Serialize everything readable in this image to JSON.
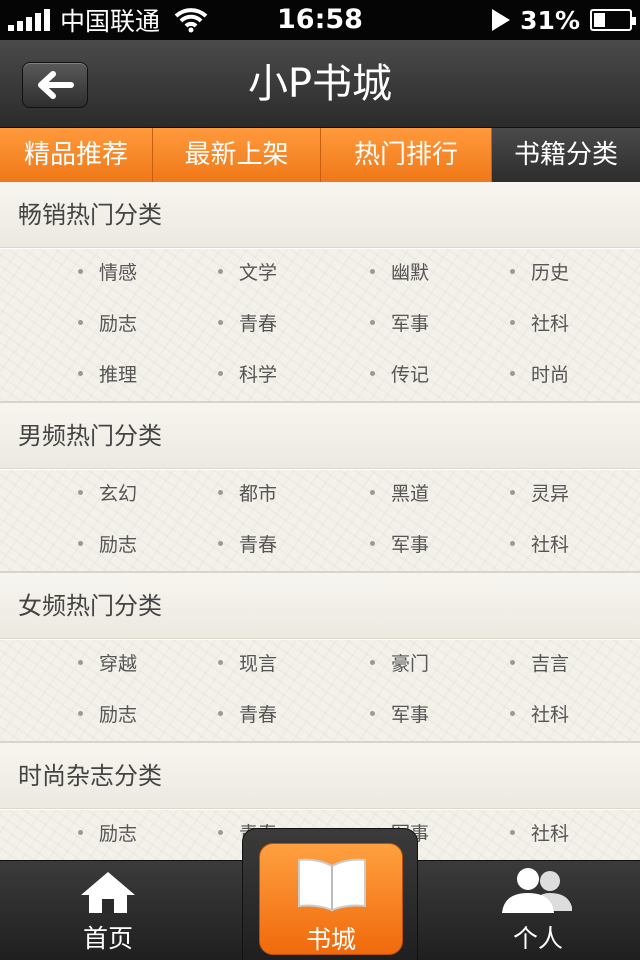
{
  "status_bar": {
    "carrier": "中国联通",
    "time": "16:58",
    "battery": "31%",
    "battery_level": 0.31
  },
  "nav": {
    "title": "小P书城",
    "back_icon": "back-arrow-icon"
  },
  "tabs": [
    {
      "label": "精品推荐",
      "active": false
    },
    {
      "label": "最新上架",
      "active": false
    },
    {
      "label": "热门排行",
      "active": false
    },
    {
      "label": "书籍分类",
      "active": true
    }
  ],
  "sections": [
    {
      "title": "畅销热门分类",
      "rows": [
        [
          "情感",
          "文学",
          "幽默",
          "历史"
        ],
        [
          "励志",
          "青春",
          "军事",
          "社科"
        ],
        [
          "推理",
          "科学",
          "传记",
          "时尚"
        ]
      ]
    },
    {
      "title": "男频热门分类",
      "rows": [
        [
          "玄幻",
          "都市",
          "黑道",
          "灵异"
        ],
        [
          "励志",
          "青春",
          "军事",
          "社科"
        ]
      ]
    },
    {
      "title": "女频热门分类",
      "rows": [
        [
          "穿越",
          "现言",
          "豪门",
          "吉言"
        ],
        [
          "励志",
          "青春",
          "军事",
          "社科"
        ]
      ]
    },
    {
      "title": "时尚杂志分类",
      "rows": [
        [
          "励志",
          "青春",
          "军事",
          "社科"
        ]
      ]
    }
  ],
  "tabbar": {
    "home": {
      "label": "首页",
      "icon": "home-icon"
    },
    "bookstore": {
      "label": "书城",
      "icon": "open-book-icon"
    },
    "me": {
      "label": "个人",
      "icon": "people-icon"
    }
  },
  "colors": {
    "accent": "#f07818",
    "bar_dark": "#2d2d2d"
  }
}
